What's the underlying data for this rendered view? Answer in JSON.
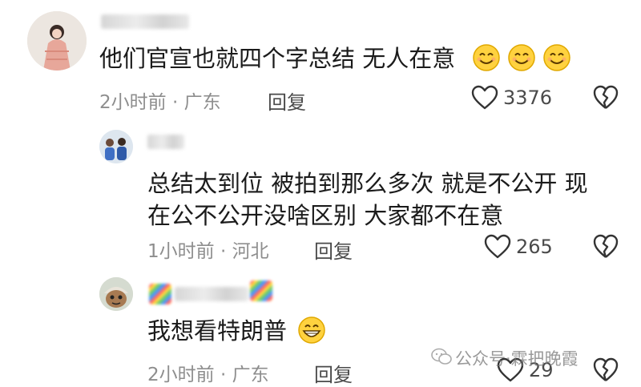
{
  "comments": [
    {
      "text": "他们官宣也就四个字总结 无人在意",
      "emoji_count": 3,
      "time": "2小时前",
      "location": "广东",
      "reply_label": "回复",
      "likes": "3376"
    },
    {
      "text_line1": "总结太到位 被拍到那么多次 就是不公开 现",
      "text_line2": "在公不公开没啥区别 大家都不在意",
      "time": "1小时前",
      "location": "河北",
      "reply_label": "回复",
      "likes": "265"
    },
    {
      "text": "我想看特朗普",
      "time": "2小时前",
      "location": "广东",
      "reply_label": "回复",
      "likes": "29"
    }
  ],
  "meta_separator": "·",
  "watermark": "公众号·霖把晚霞",
  "colors": {
    "text": "#1b1b1b",
    "meta": "#8e8e8e",
    "emoji_face": "#ffd23f"
  },
  "icons": [
    "heart-outline-icon",
    "broken-heart-icon",
    "smile-emoji-icon",
    "grin-emoji-icon",
    "wechat-icon"
  ]
}
